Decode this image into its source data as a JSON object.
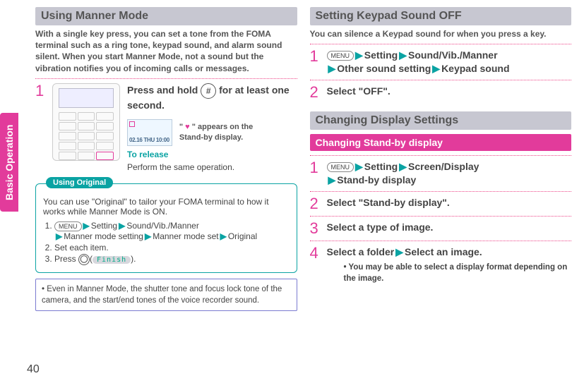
{
  "side_tab": "Basic Operation",
  "page_number": "40",
  "left": {
    "title": "Using Manner Mode",
    "intro": "With a single key press, you can set a tone from the FOMA terminal such as a ring tone, keypad sound, and alarm sound silent. When you start Manner Mode, not a sound but the vibration notifies you of incoming calls or messages.",
    "step1_num": "1",
    "step1_a": "Press and hold ",
    "step1_key": "#",
    "step1_b": " for at least one second.",
    "standby_caption_a": "\" ",
    "standby_caption_b": " \" appears on the Stand-by display.",
    "release_label": "To release",
    "release_text": "Perform the same operation.",
    "tip_tab": "Using Original",
    "tip_intro": "You can use \"Original\" to tailor your FOMA terminal to how it works while Manner Mode is ON.",
    "tip_li1_menu": "MENU",
    "tip_li1_parts": {
      "a": "Setting",
      "b": "Sound/Vib./Manner",
      "c": "Manner mode setting",
      "d": "Manner mode set",
      "e": "Original"
    },
    "tip_li2": "Set each item.",
    "tip_li3_a": "Press ",
    "tip_li3_finish": "Finish",
    "tip_li3_b": ".",
    "note": "Even in Manner Mode, the shutter tone and focus lock tone of the camera, and the start/end tones of the voice recorder sound."
  },
  "right": {
    "sec1_title": "Setting Keypad Sound OFF",
    "sec1_intro": "You can silence a Keypad sound for when you press a key.",
    "s1_step1_num": "1",
    "s1_step1_menu": "MENU",
    "s1_step1": {
      "a": "Setting",
      "b": "Sound/Vib./Manner",
      "c": "Other sound setting",
      "d": "Keypad sound"
    },
    "s1_step2_num": "2",
    "s1_step2": "Select \"OFF\".",
    "sec2_title": "Changing Display Settings",
    "sec2_sub": "Changing Stand-by display",
    "s2_step1_num": "1",
    "s2_step1_menu": "MENU",
    "s2_step1": {
      "a": "Setting",
      "b": "Screen/Display",
      "c": "Stand-by display"
    },
    "s2_step2_num": "2",
    "s2_step2": "Select \"Stand-by display\".",
    "s2_step3_num": "3",
    "s2_step3": "Select a type of image.",
    "s2_step4_num": "4",
    "s2_step4_a": "Select a folder",
    "s2_step4_b": "Select an image.",
    "s2_step4_note": "You may be able to select a display format depending on the image."
  }
}
